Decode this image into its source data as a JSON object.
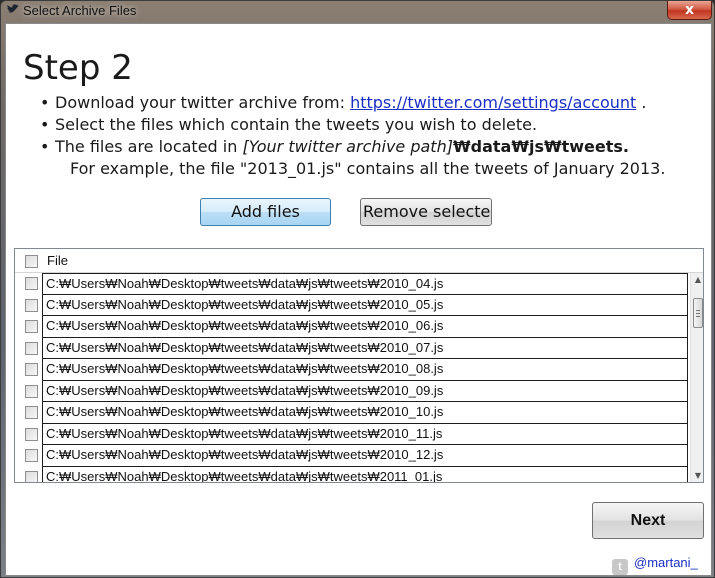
{
  "window": {
    "title": "Select Archive Files",
    "close_glyph": "x"
  },
  "step": {
    "title": "Step 2",
    "bullet_glyph": "•",
    "line1_prefix": "Download your twitter archive from: ",
    "line1_link": "https://twitter.com/settings/account",
    "line1_suffix": " .",
    "line2": "Select the files which contain the tweets you wish to delete.",
    "line3_prefix": "The files are located in ",
    "line3_italic": "[Your twitter archive path]",
    "line3_bold": "₩data₩js₩tweets.",
    "line4": "For example, the file \"2013_01.js\" contains all the tweets of January 2013."
  },
  "buttons": {
    "add": "Add files",
    "remove": "Remove selected",
    "next": "Next"
  },
  "list": {
    "header": "File",
    "rows": [
      "C:₩Users₩Noah₩Desktop₩tweets₩data₩js₩tweets₩2010_04.js",
      "C:₩Users₩Noah₩Desktop₩tweets₩data₩js₩tweets₩2010_05.js",
      "C:₩Users₩Noah₩Desktop₩tweets₩data₩js₩tweets₩2010_06.js",
      "C:₩Users₩Noah₩Desktop₩tweets₩data₩js₩tweets₩2010_07.js",
      "C:₩Users₩Noah₩Desktop₩tweets₩data₩js₩tweets₩2010_08.js",
      "C:₩Users₩Noah₩Desktop₩tweets₩data₩js₩tweets₩2010_09.js",
      "C:₩Users₩Noah₩Desktop₩tweets₩data₩js₩tweets₩2010_10.js",
      "C:₩Users₩Noah₩Desktop₩tweets₩data₩js₩tweets₩2010_11.js",
      "C:₩Users₩Noah₩Desktop₩tweets₩data₩js₩tweets₩2010_12.js",
      "C:₩Users₩Noah₩Desktop₩tweets₩data₩js₩tweets₩2011_01.js"
    ]
  },
  "footer": {
    "credit": "@martani_",
    "icon": "twitter-bird-icon"
  },
  "colors": {
    "link": "#1a2fc6",
    "close": "#c2351f",
    "add_button_border": "#3c7fb1"
  }
}
